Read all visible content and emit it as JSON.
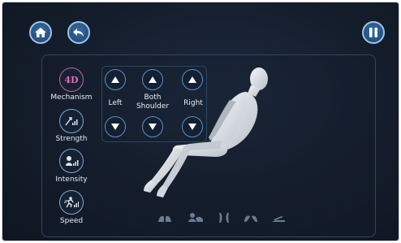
{
  "header": {
    "home_icon": "home-icon",
    "back_icon": "back-arrow-icon",
    "pause_icon": "pause-icon"
  },
  "modes": [
    {
      "label": "Mechanism",
      "badge": "4D",
      "icon": "mechanism-4d-icon",
      "active": true
    },
    {
      "label": "Strength",
      "icon": "strength-icon",
      "active": false
    },
    {
      "label": "Intensity",
      "icon": "intensity-icon",
      "active": false
    },
    {
      "label": "Speed",
      "icon": "speed-icon",
      "active": false
    }
  ],
  "positions": {
    "left_label": "Left",
    "both_label": "Both\nShoulder",
    "right_label": "Right"
  },
  "bottom_icons": [
    "hands-icon",
    "shoulder-icon",
    "legs-icon",
    "feet-icon",
    "recline-icon"
  ],
  "colors": {
    "background": "#141d2b",
    "accent": "#5e8fc4",
    "active_mode": "#c65fa8",
    "button_fill": "#24507e"
  }
}
